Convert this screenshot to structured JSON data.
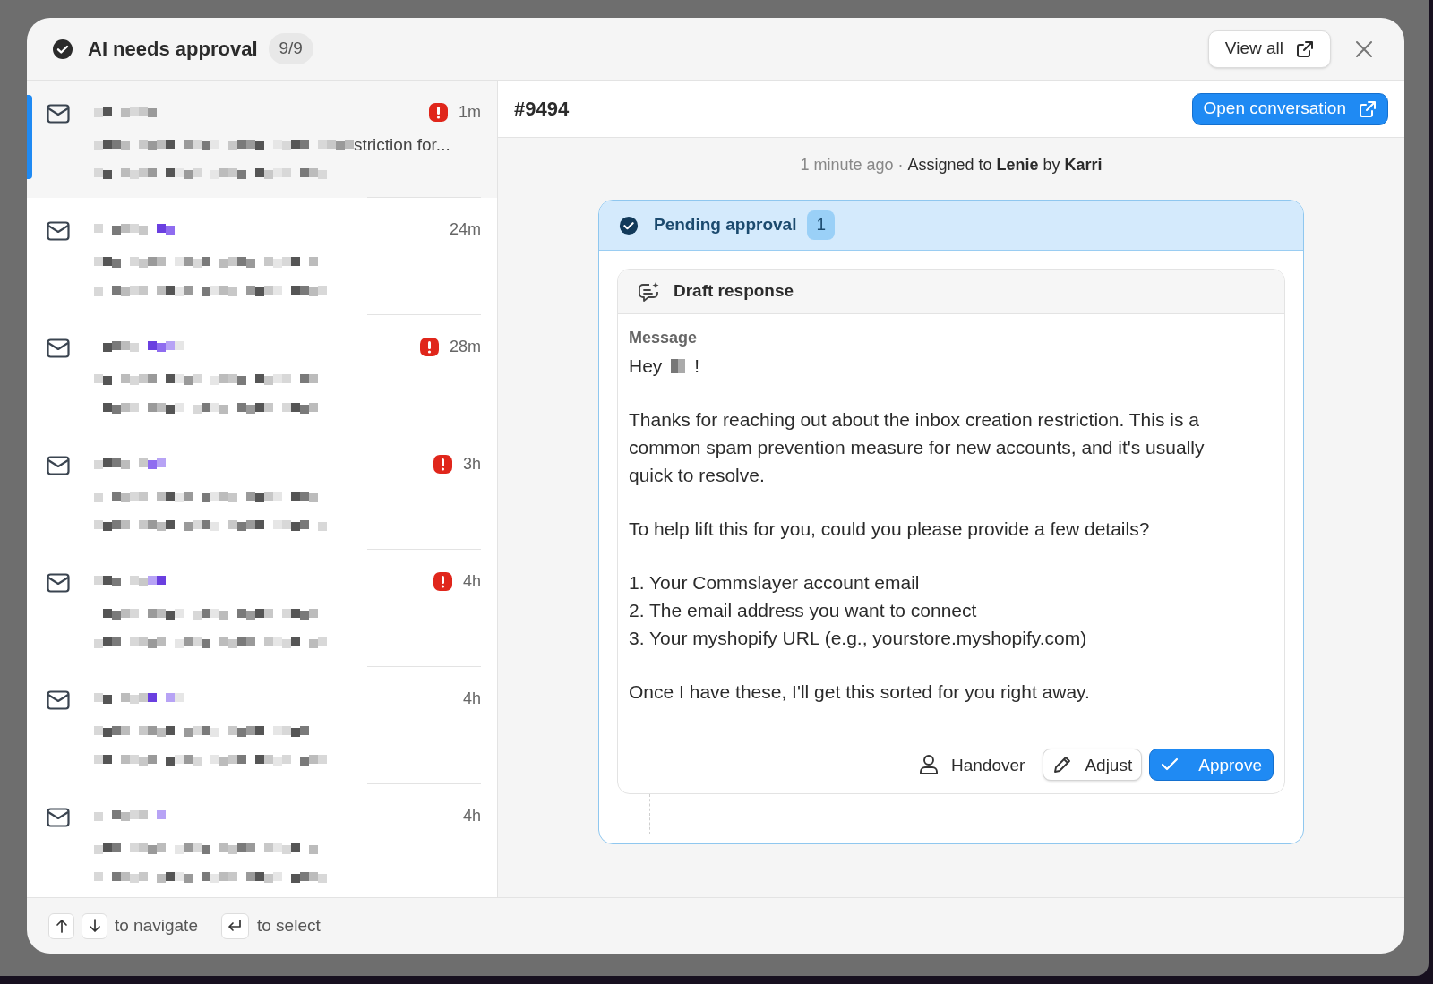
{
  "header": {
    "title": "AI needs approval",
    "count": "9/9",
    "view_all": "View all"
  },
  "conversations": [
    {
      "time": "1m",
      "alert": true,
      "selected": true,
      "preview_tail": "striction for..."
    },
    {
      "time": "24m",
      "alert": false,
      "selected": false
    },
    {
      "time": "28m",
      "alert": true,
      "selected": false
    },
    {
      "time": "3h",
      "alert": true,
      "selected": false
    },
    {
      "time": "4h",
      "alert": true,
      "selected": false
    },
    {
      "time": "4h",
      "alert": false,
      "selected": false
    },
    {
      "time": "4h",
      "alert": false,
      "selected": false
    }
  ],
  "detail": {
    "ticket": "#9494",
    "open_button": "Open conversation",
    "meta_time": "1 minute ago ·",
    "meta_assignment": "Assigned to **Lenie** by **Karri**",
    "pending": {
      "title": "Pending approval",
      "count": "1"
    },
    "draft": {
      "title": "Draft response",
      "label": "Message",
      "greeting_before": "Hey",
      "greeting_after": "!",
      "blocks": [
        {
          "kind": "paragraph",
          "text": "Thanks for reaching out about the inbox creation restriction. This is a common spam prevention measure for new accounts, and it's usually quick to resolve."
        },
        {
          "kind": "paragraph",
          "text": "To help lift this for you, could you please provide a few details?"
        },
        {
          "kind": "list",
          "items": [
            "1. Your Commslayer account email",
            "2. The email address you want to connect",
            "3. Your myshopify URL (e.g., yourstore.myshopify.com)"
          ]
        },
        {
          "kind": "paragraph",
          "text": "Once I have these, I'll get this sorted for you right away."
        }
      ],
      "buttons": {
        "handover": "Handover",
        "adjust": "Adjust",
        "approve": "Approve"
      }
    }
  },
  "footer": {
    "navigate": "to navigate",
    "select": "to select"
  }
}
